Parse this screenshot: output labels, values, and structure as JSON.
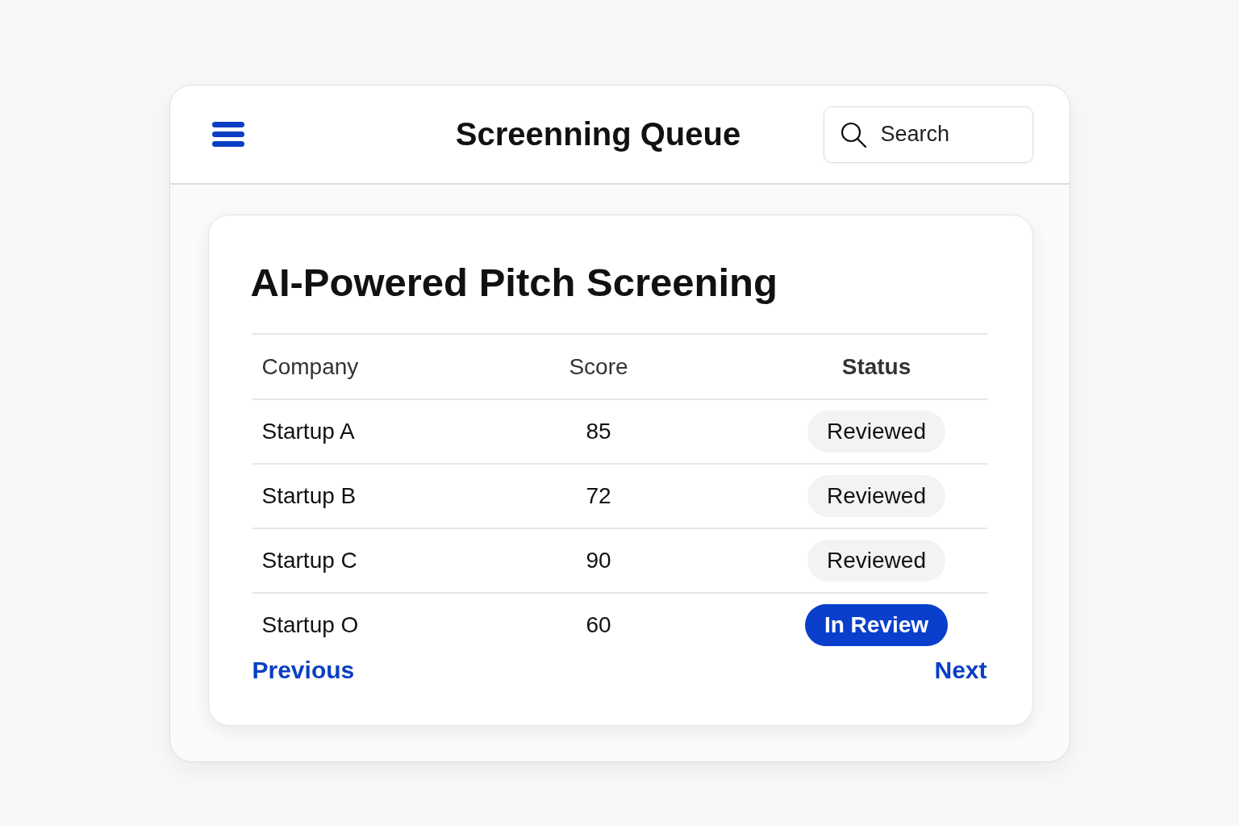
{
  "header": {
    "title": "Screenning Queue",
    "search": {
      "placeholder": "Search"
    }
  },
  "card": {
    "title": "AI-Powered Pitch Screening",
    "columns": [
      {
        "label": "Company",
        "emphasized": false
      },
      {
        "label": "Score",
        "emphasized": false
      },
      {
        "label": "Status",
        "emphasized": true
      }
    ],
    "rows": [
      {
        "company": "Startup A",
        "score": "85",
        "status": {
          "label": "Reviewed",
          "kind": "reviewed"
        }
      },
      {
        "company": "Startup B",
        "score": "72",
        "status": {
          "label": "Reviewed",
          "kind": "reviewed"
        }
      },
      {
        "company": "Startup C",
        "score": "90",
        "status": {
          "label": "Reviewed",
          "kind": "reviewed"
        }
      },
      {
        "company": "Startup O",
        "score": "60",
        "status": {
          "label": "In Review",
          "kind": "in_review"
        }
      }
    ],
    "pagination": {
      "previous": "Previous",
      "next": "Next"
    }
  }
}
